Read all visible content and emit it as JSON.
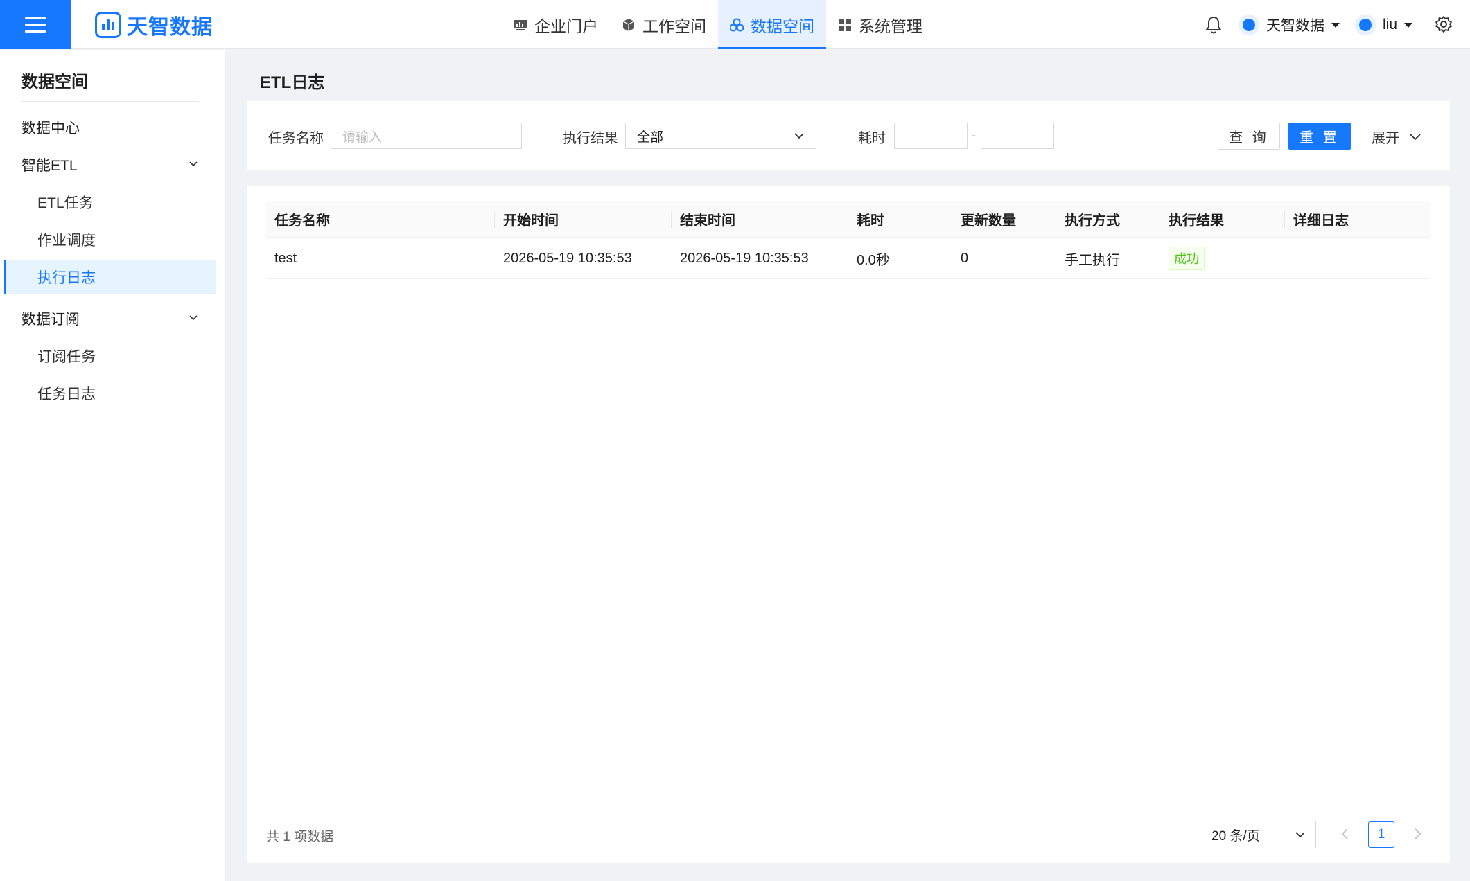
{
  "header": {
    "logo_text": "天智数据",
    "nav": [
      {
        "label": "企业门户",
        "icon": "chart-board-icon"
      },
      {
        "label": "工作空间",
        "icon": "cube-icon"
      },
      {
        "label": "数据空间",
        "icon": "cluster-icon",
        "active": true
      },
      {
        "label": "系统管理",
        "icon": "grid-icon"
      }
    ],
    "tenant": "天智数据",
    "user": "liu",
    "accent_color": "#1677ff"
  },
  "sidebar": {
    "title": "数据空间",
    "items": [
      {
        "label": "数据中心",
        "level": 1
      },
      {
        "label": "智能ETL",
        "level": 1,
        "expandable": true
      },
      {
        "label": "ETL任务",
        "level": 2
      },
      {
        "label": "作业调度",
        "level": 2
      },
      {
        "label": "执行日志",
        "level": 2,
        "active": true
      },
      {
        "label": "数据订阅",
        "level": 1,
        "expandable": true
      },
      {
        "label": "订阅任务",
        "level": 2
      },
      {
        "label": "任务日志",
        "level": 2
      }
    ]
  },
  "page": {
    "title": "ETL日志"
  },
  "filters": {
    "task_name_label": "任务名称",
    "task_name_placeholder": "请输入",
    "result_label": "执行结果",
    "result_value": "全部",
    "duration_label": "耗时",
    "duration_sep": "-",
    "query_button": "查 询",
    "reset_button": "重 置",
    "expand_label": "展开"
  },
  "table": {
    "columns": [
      "任务名称",
      "开始时间",
      "结束时间",
      "耗时",
      "更新数量",
      "执行方式",
      "执行结果",
      "详细日志"
    ],
    "rows": [
      {
        "task_name": "test",
        "start_time": "2026-05-19 10:35:53",
        "end_time": "2026-05-19 10:35:53",
        "duration": "0.0秒",
        "update_count": "0",
        "exec_mode": "手工执行",
        "result": "成功",
        "detail": ""
      }
    ]
  },
  "pagination": {
    "total_text": "共 1 项数据",
    "page_size": "20 条/页",
    "current_page": "1"
  }
}
